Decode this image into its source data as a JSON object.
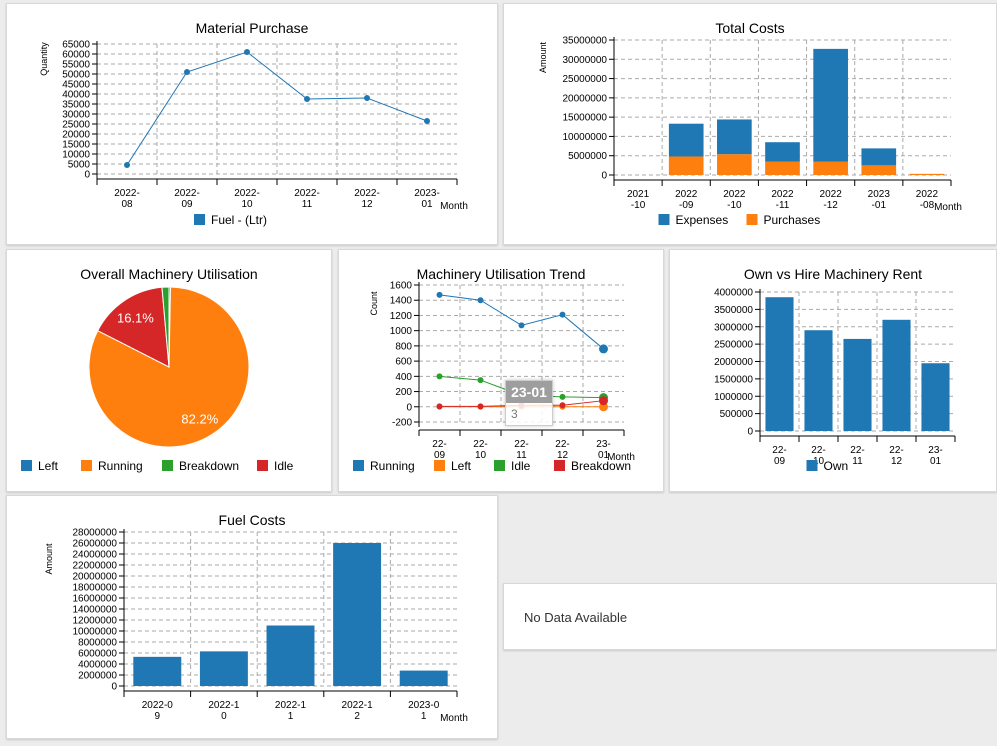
{
  "colors": {
    "blue": "#1f77b4",
    "orange": "#ff7f0e",
    "green": "#2ca02c",
    "red": "#d62728"
  },
  "no_data": "No Data Available",
  "tooltip": {
    "title": "23-01",
    "value": "3"
  },
  "chart_data": [
    {
      "id": "material",
      "type": "line",
      "title": "Material Purchase",
      "xlabel": "Month",
      "ylabel": "Quantity",
      "ylim": [
        0,
        65000
      ],
      "ystep": 5000,
      "grid": true,
      "categories": [
        "2022-\n08",
        "2022-\n09",
        "2022-\n10",
        "2022-\n11",
        "2022-\n12",
        "2023-\n01"
      ],
      "series": [
        {
          "name": "Fuel - (Ltr)",
          "color": "#1f77b4",
          "values": [
            4500,
            51000,
            61000,
            37500,
            38000,
            26500
          ]
        }
      ],
      "legend": "bottom"
    },
    {
      "id": "totalcosts",
      "type": "bar",
      "stacked": true,
      "title": "Total Costs",
      "xlabel": "Month",
      "ylabel": "Amount",
      "ylim": [
        0,
        35000000
      ],
      "ystep": 5000000,
      "grid": true,
      "categories": [
        "2021\n-10",
        "2022\n-09",
        "2022\n-10",
        "2022\n-11",
        "2022\n-12",
        "2023\n-01",
        "2022\n-08"
      ],
      "series": [
        {
          "name": "Purchases",
          "color": "#ff7f0e",
          "values": [
            0,
            4800000,
            5400000,
            3500000,
            3500000,
            2500000,
            300000
          ]
        },
        {
          "name": "Expenses",
          "color": "#1f77b4",
          "values": [
            0,
            8500000,
            9000000,
            5000000,
            29200000,
            4400000,
            0
          ]
        }
      ],
      "legend_order": [
        "Expenses",
        "Purchases"
      ],
      "legend": "bottom"
    },
    {
      "id": "pie",
      "type": "pie",
      "title": "Overall Machinery Utilisation",
      "slices": [
        {
          "name": "Left",
          "color": "#1f77b4",
          "value": 0.3
        },
        {
          "name": "Running",
          "color": "#ff7f0e",
          "value": 82.2,
          "label": "82.2%"
        },
        {
          "name": "Idle",
          "color": "#d62728",
          "value": 16.1,
          "label": "16.1%"
        },
        {
          "name": "Breakdown",
          "color": "#2ca02c",
          "value": 1.4
        }
      ],
      "legend_order": [
        "Left",
        "Running",
        "Breakdown",
        "Idle"
      ],
      "legend": "bottom"
    },
    {
      "id": "trend",
      "type": "line",
      "title": "Machinery Utilisation Trend",
      "xlabel": "Month",
      "ylabel": "Count",
      "ylim": [
        -200,
        1600
      ],
      "ystep": 200,
      "grid": true,
      "categories": [
        "22-\n09",
        "22-\n10",
        "22-\n11",
        "22-\n12",
        "23-\n01"
      ],
      "series": [
        {
          "name": "Running",
          "color": "#1f77b4",
          "values": [
            1470,
            1400,
            1070,
            1210,
            760
          ]
        },
        {
          "name": "Left",
          "color": "#ff7f0e",
          "values": [
            0,
            0,
            0,
            0,
            0
          ]
        },
        {
          "name": "Idle",
          "color": "#2ca02c",
          "values": [
            400,
            350,
            150,
            130,
            120
          ]
        },
        {
          "name": "Breakdown",
          "color": "#d62728",
          "values": [
            5,
            5,
            20,
            20,
            80
          ]
        }
      ],
      "legend": "bottom"
    },
    {
      "id": "rent",
      "type": "bar",
      "title": "Own vs Hire Machinery Rent",
      "xlabel": "",
      "ylabel": "",
      "ylim": [
        0,
        4000000
      ],
      "ystep": 500000,
      "grid": true,
      "categories": [
        "22-\n09",
        "22-\n10",
        "22-\n11",
        "22-\n12",
        "23-\n01"
      ],
      "series": [
        {
          "name": "Own",
          "color": "#1f77b4",
          "values": [
            3850000,
            2900000,
            2650000,
            3200000,
            1950000
          ]
        }
      ],
      "legend": "bottom"
    },
    {
      "id": "fuel",
      "type": "bar",
      "title": "Fuel Costs",
      "xlabel": "Month",
      "ylabel": "Amount",
      "ylim": [
        0,
        28000000
      ],
      "ystep": 2000000,
      "grid": true,
      "categories": [
        "2022-0\n9",
        "2022-1\n0",
        "2022-1\n1",
        "2022-1\n2",
        "2023-0\n1"
      ],
      "series": [
        {
          "color": "#1f77b4",
          "values": [
            5300000,
            6300000,
            11000000,
            26000000,
            2800000
          ]
        }
      ]
    }
  ]
}
